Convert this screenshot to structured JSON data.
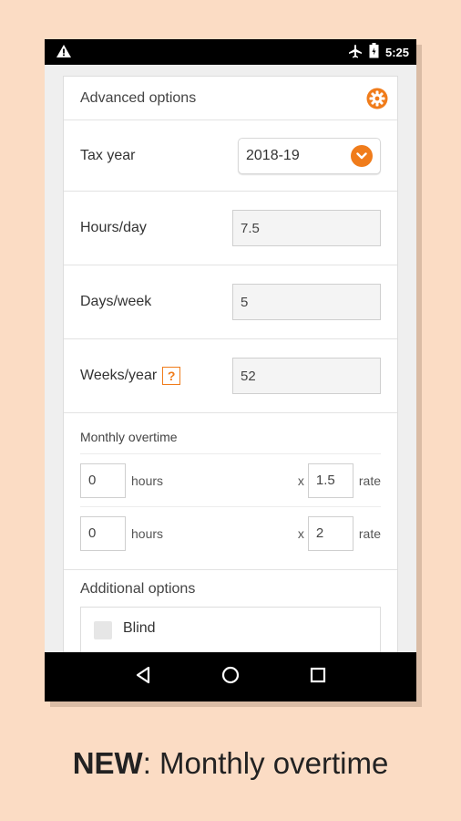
{
  "status": {
    "time": "5:25",
    "icons": [
      "warning-icon",
      "airplane-icon",
      "battery-icon"
    ]
  },
  "advanced": {
    "title": "Advanced options"
  },
  "tax_year": {
    "label": "Tax year",
    "value": "2018-19"
  },
  "hours_day": {
    "label": "Hours/day",
    "value": "7.5"
  },
  "days_week": {
    "label": "Days/week",
    "value": "5"
  },
  "weeks_year": {
    "label": "Weeks/year",
    "help": "?",
    "value": "52"
  },
  "overtime": {
    "title": "Monthly overtime",
    "rows": [
      {
        "hours": "0",
        "hours_label": "hours",
        "x": "x",
        "rate": "1.5",
        "rate_label": "rate"
      },
      {
        "hours": "0",
        "hours_label": "hours",
        "x": "x",
        "rate": "2",
        "rate_label": "rate"
      }
    ]
  },
  "additional": {
    "title": "Additional options",
    "options": [
      {
        "label": "Blind",
        "checked": false
      }
    ]
  },
  "caption": {
    "bold": "NEW",
    "rest": ": Monthly overtime"
  },
  "colors": {
    "accent": "#f07c1b",
    "background": "#fbdcc4"
  }
}
